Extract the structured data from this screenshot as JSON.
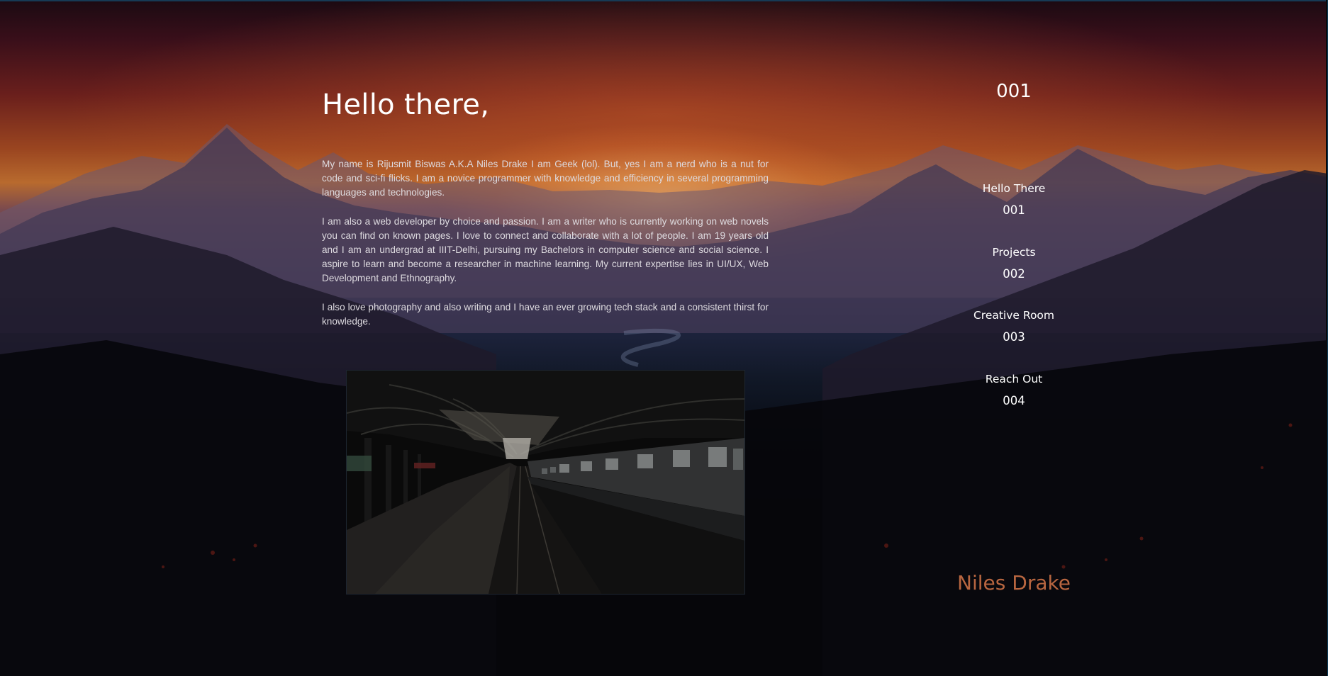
{
  "intro": {
    "heading": "Hello there,",
    "paragraphs": [
      "My name is Rijusmit Biswas A.K.A Niles Drake I am Geek (lol). But, yes I am a nerd who is a nut for code and sci-fi flicks. I am a novice programmer with knowledge and efficiency in several programming languages and technologies.",
      "I am also a web developer by choice and passion. I am a writer who is currently working on web novels you can find on known pages. I love to connect and collaborate with a lot of people. I am 19 years old and I am an undergrad at IIIT-Delhi, pursuing my Bachelors in computer science and social science. I aspire to learn and become a researcher in machine learning. My current expertise lies in UI/UX, Web Development and Ethnography.",
      "I also love photography and also writing and I have an ever growing tech stack and a consistent thirst for knowledge."
    ]
  },
  "section_number": "001",
  "nav": {
    "items": [
      {
        "label": "Hello There",
        "number": "001"
      },
      {
        "label": "Projects",
        "number": "002"
      },
      {
        "label": "Creative Room",
        "number": "003"
      },
      {
        "label": "Reach Out",
        "number": "004"
      }
    ]
  },
  "signature": "Niles Drake",
  "colors": {
    "accent": "#b86640",
    "text": "#ffffff"
  }
}
